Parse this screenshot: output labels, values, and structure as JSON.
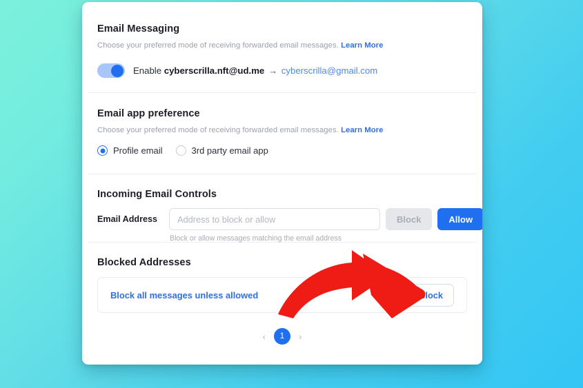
{
  "background": {
    "gradient_from": "#7cf0dc",
    "gradient_to": "#33c6f4"
  },
  "theme": {
    "accent_blue": "#1f6ff0",
    "link_blue": "#2f6fe4",
    "annotation_red": "#ef1c16",
    "card_background": "#ffffff",
    "muted_text": "#9aa1ab"
  },
  "sections": {
    "email_messaging": {
      "title": "Email Messaging",
      "description": "Choose your preferred mode of receiving forwarded email messages.",
      "learn_more": "Learn More",
      "toggle_enabled": "true",
      "enable_label": "Enable",
      "source_address": "cyberscrilla.nft@ud.me",
      "arrow_glyph": "→",
      "destination_address": "cyberscrilla@gmail.com"
    },
    "email_app_preference": {
      "title": "Email app preference",
      "description": "Choose your preferred mode of receiving forwarded email messages.",
      "learn_more": "Learn More",
      "options": [
        {
          "label": "Profile email",
          "selected": "true"
        },
        {
          "label": "3rd party email app",
          "selected": "false"
        }
      ]
    },
    "incoming_email_controls": {
      "title": "Incoming Email Controls",
      "field_label": "Email Address",
      "input_value": "",
      "input_placeholder": "Address to block or allow",
      "block_button": "Block",
      "allow_button": "Allow",
      "helper_text": "Block or allow messages matching the email address"
    },
    "blocked_addresses": {
      "title": "Blocked Addresses",
      "rows": [
        {
          "label": "Block all messages unless allowed",
          "action": "Unblock"
        }
      ],
      "pagination": {
        "prev": "‹",
        "current_page": "1",
        "next": "›"
      }
    }
  },
  "annotation": {
    "type": "curved-arrow",
    "color": "#ef1c16",
    "points_to": "Unblock"
  }
}
